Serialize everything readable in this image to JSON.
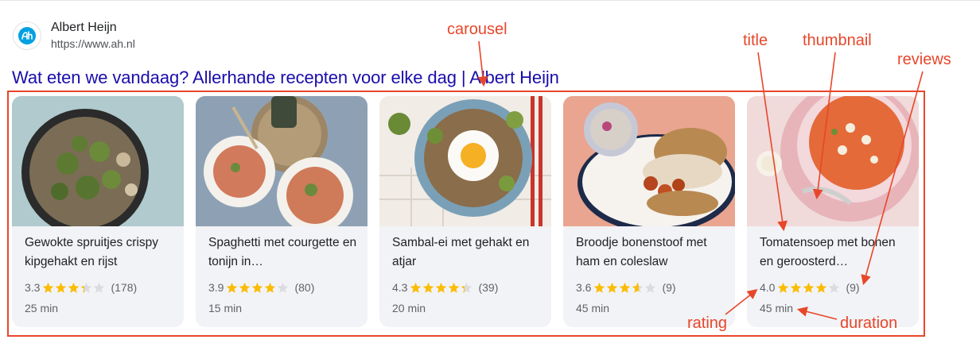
{
  "site": {
    "name": "Albert Heijn",
    "url": "https://www.ah.nl"
  },
  "result_title": "Wat eten we vandaag? Allerhande recepten voor elke dag | Albert Heijn",
  "colors": {
    "accent": "#1a0dab",
    "annotation": "#e8462a",
    "star": "#fbbc04",
    "card_bg": "#f2f3f6"
  },
  "cards": [
    {
      "title": "Gewokte spruitjes crispy kipgehakt en rijst",
      "rating": "3.3",
      "rating_value": 3.3,
      "reviews": "(178)",
      "duration": "25 min"
    },
    {
      "title": "Spaghetti met courgette en tonijn in…",
      "rating": "3.9",
      "rating_value": 3.9,
      "reviews": "(80)",
      "duration": "15 min"
    },
    {
      "title": "Sambal-ei met gehakt en atjar",
      "rating": "4.3",
      "rating_value": 4.3,
      "reviews": "(39)",
      "duration": "20 min"
    },
    {
      "title": "Broodje bonenstoof met ham en coleslaw",
      "rating": "3.6",
      "rating_value": 3.6,
      "reviews": "(9)",
      "duration": "45 min"
    },
    {
      "title": "Tomatensoep met bonen en geroosterd…",
      "rating": "4.0",
      "rating_value": 4.0,
      "reviews": "(9)",
      "duration": "45 min"
    }
  ],
  "annotations": {
    "carousel": "carousel",
    "title": "title",
    "thumbnail": "thumbnail",
    "reviews": "reviews",
    "rating": "rating",
    "duration": "duration"
  }
}
